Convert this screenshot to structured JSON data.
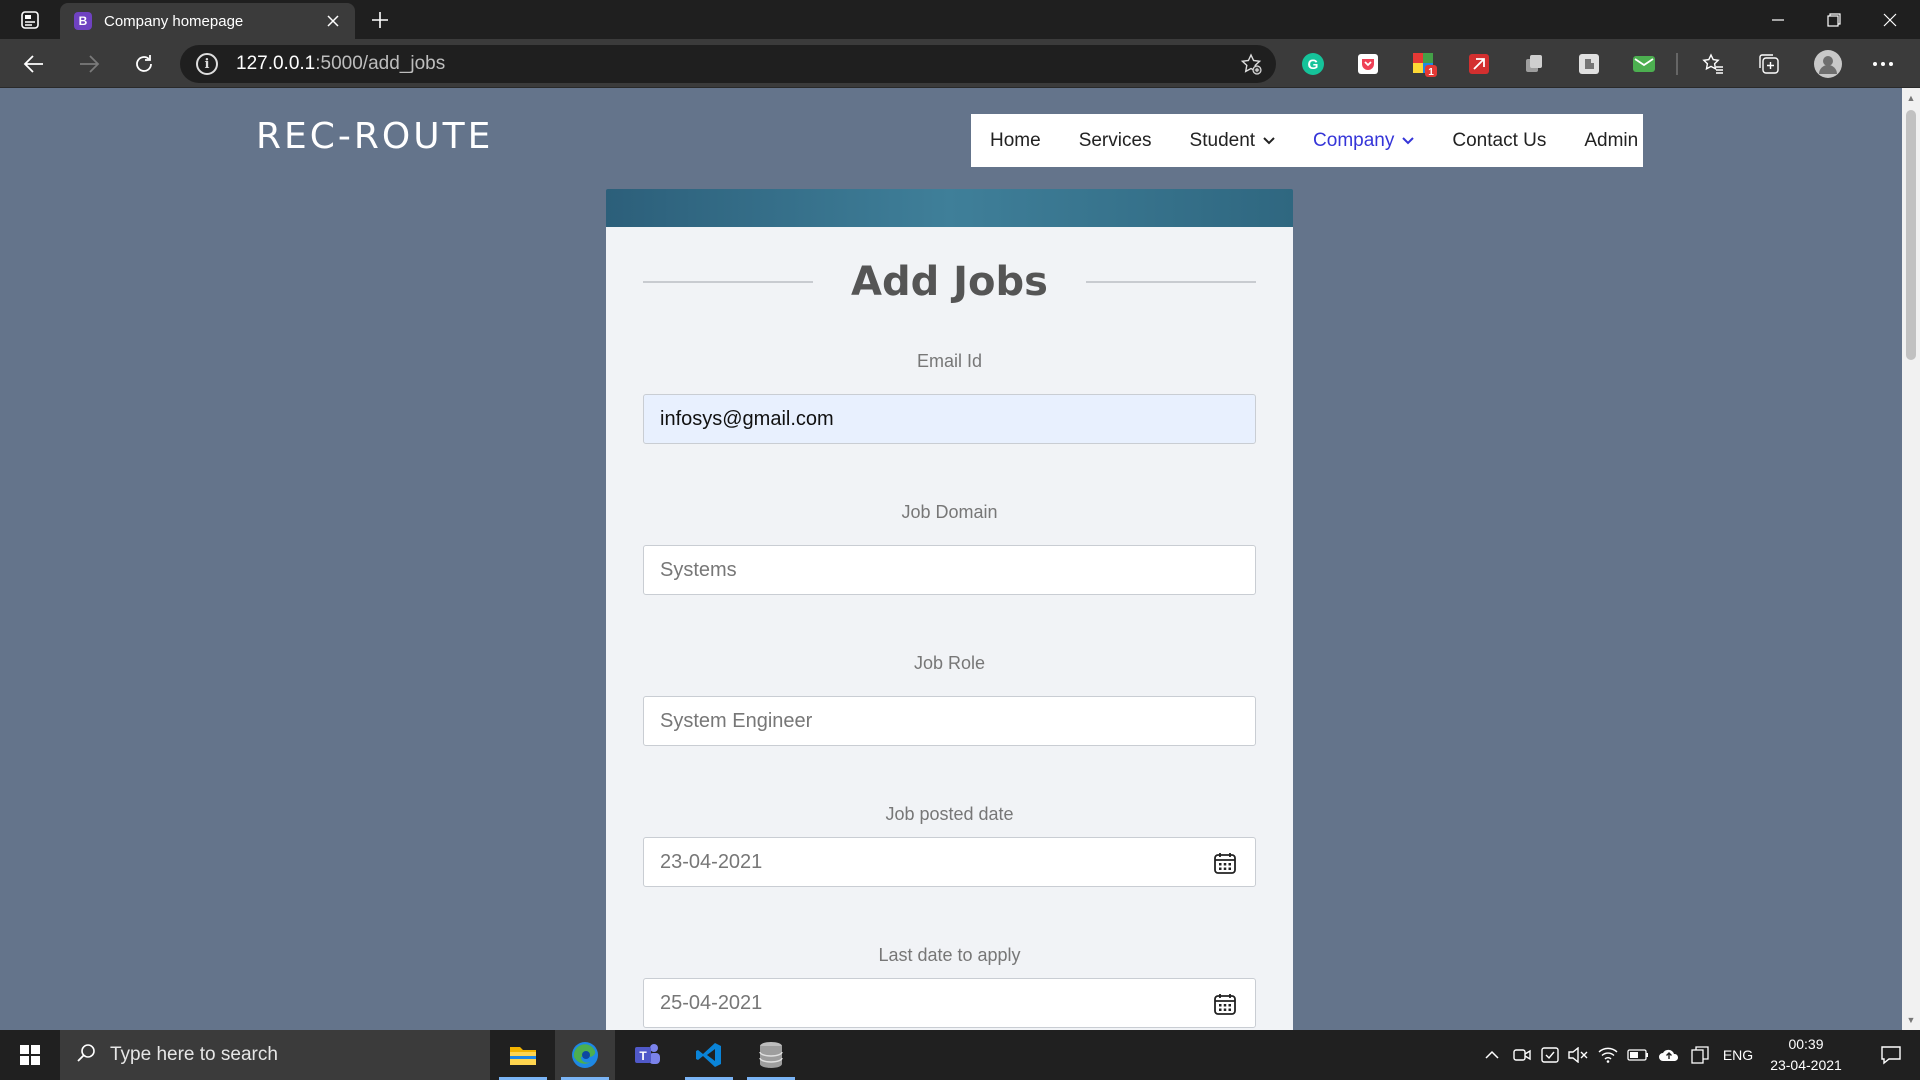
{
  "browser": {
    "tab": {
      "favicon_letter": "B",
      "title": "Company homepage"
    },
    "address": {
      "host": "127.0.0.1",
      "path": ":5000/add_jobs"
    },
    "extensions": [
      "grammarly-icon",
      "pocket-icon",
      "badge-extension-icon",
      "pdf-extension-icon",
      "copy-extension-icon",
      "puzzle-extension-icon",
      "mail-extension-icon"
    ],
    "extension_badge": "1"
  },
  "site": {
    "brand": "REC-ROUTE",
    "nav": [
      {
        "label": "Home",
        "dropdown": false,
        "active": false
      },
      {
        "label": "Services",
        "dropdown": false,
        "active": false
      },
      {
        "label": "Student",
        "dropdown": true,
        "active": false
      },
      {
        "label": "Company",
        "dropdown": true,
        "active": true
      },
      {
        "label": "Contact Us",
        "dropdown": false,
        "active": false
      },
      {
        "label": "Admin",
        "dropdown": false,
        "active": false
      }
    ]
  },
  "form": {
    "title": "Add Jobs",
    "fields": [
      {
        "label": "Email Id",
        "value": "infosys@gmail.com",
        "type": "email"
      },
      {
        "label": "Job Domain",
        "placeholder": "Systems",
        "type": "text"
      },
      {
        "label": "Job Role",
        "placeholder": "System Engineer",
        "type": "text"
      },
      {
        "label": "Job posted date",
        "value": "23-04-2021",
        "type": "date"
      },
      {
        "label": "Last date to apply",
        "value": "25-04-2021",
        "type": "date"
      }
    ]
  },
  "taskbar": {
    "search_placeholder": "Type here to search",
    "language": "ENG",
    "time": "00:39",
    "date": "23-04-2021"
  },
  "colors": {
    "page_background": "#64748b",
    "card_header": "#3f7f99",
    "nav_active": "#3535d8",
    "input_autofill": "#e8f0fe"
  }
}
